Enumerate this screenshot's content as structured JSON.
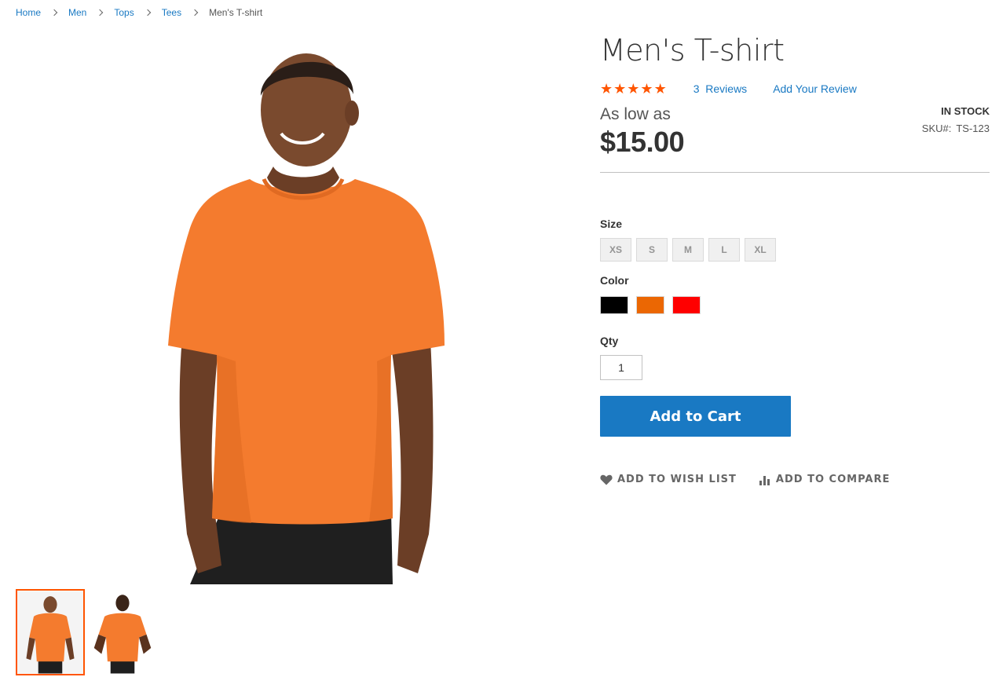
{
  "breadcrumb": {
    "items": [
      "Home",
      "Men",
      "Tops",
      "Tees"
    ],
    "current": "Men's T-shirt"
  },
  "product": {
    "title": "Men's T-shirt",
    "rating_percent": 100,
    "reviews_count": "3",
    "reviews_label": "Reviews",
    "add_review_label": "Add Your Review",
    "price_prefix": "As low as",
    "price": "$15.00",
    "stock_status": "In stock",
    "sku_label": "SKU#:",
    "sku_value": "TS-123"
  },
  "options": {
    "size_label": "Size",
    "sizes": [
      "XS",
      "S",
      "M",
      "L",
      "XL"
    ],
    "color_label": "Color",
    "colors": [
      "#000000",
      "#eb6703",
      "#ff0000"
    ],
    "qty_label": "Qty",
    "qty_value": "1"
  },
  "cart": {
    "add_to_cart_label": "Add to Cart"
  },
  "actions": {
    "wishlist_label": "Add to Wish List",
    "compare_label": "Add to Compare"
  },
  "gallery": {
    "thumbnails": [
      "front-view",
      "back-view"
    ],
    "active_index": 0
  },
  "colors": {
    "accent": "#1979c3",
    "star": "#ff5501",
    "active_thumb_border": "#ff5501",
    "shirt": "#f47b2e"
  }
}
